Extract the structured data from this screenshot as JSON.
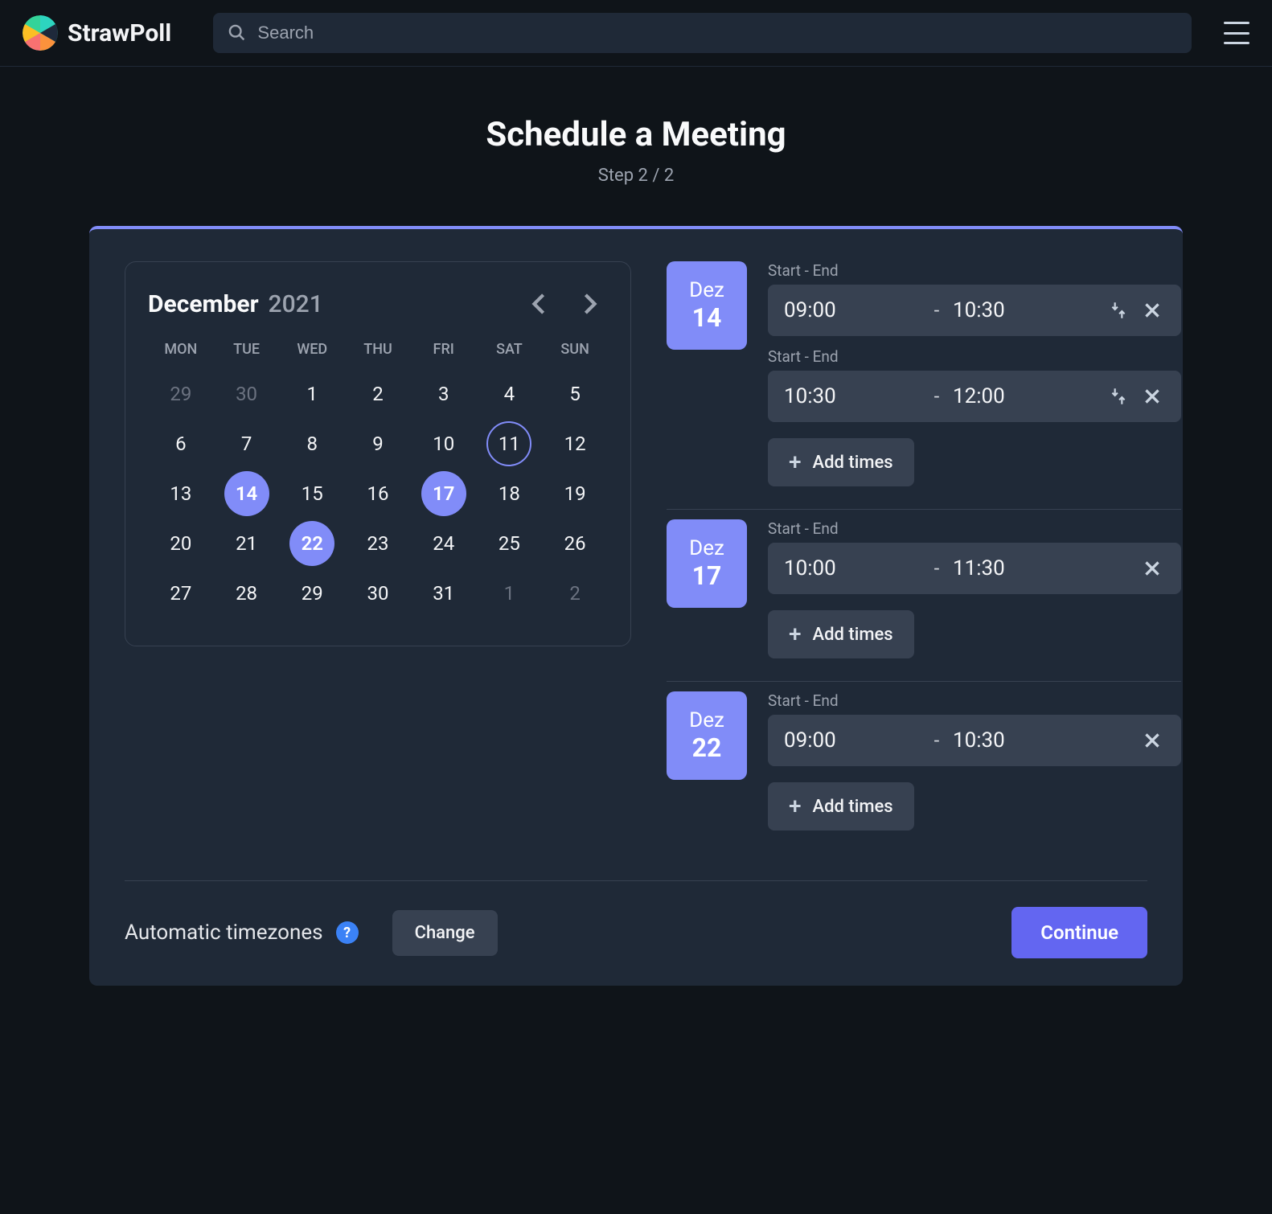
{
  "brand": "StrawPoll",
  "search": {
    "placeholder": "Search"
  },
  "title": "Schedule a Meeting",
  "step": "Step 2 / 2",
  "calendar": {
    "month": "December",
    "year": "2021",
    "dow": [
      "MON",
      "TUE",
      "WED",
      "THU",
      "FRI",
      "SAT",
      "SUN"
    ],
    "weeks": [
      [
        {
          "n": "29",
          "muted": true
        },
        {
          "n": "30",
          "muted": true
        },
        {
          "n": "1"
        },
        {
          "n": "2"
        },
        {
          "n": "3"
        },
        {
          "n": "4"
        },
        {
          "n": "5"
        }
      ],
      [
        {
          "n": "6"
        },
        {
          "n": "7"
        },
        {
          "n": "8"
        },
        {
          "n": "9"
        },
        {
          "n": "10"
        },
        {
          "n": "11",
          "today": true
        },
        {
          "n": "12"
        }
      ],
      [
        {
          "n": "13"
        },
        {
          "n": "14",
          "selected": true
        },
        {
          "n": "15"
        },
        {
          "n": "16"
        },
        {
          "n": "17",
          "selected": true
        },
        {
          "n": "18"
        },
        {
          "n": "19"
        }
      ],
      [
        {
          "n": "20"
        },
        {
          "n": "21"
        },
        {
          "n": "22",
          "selected": true
        },
        {
          "n": "23"
        },
        {
          "n": "24"
        },
        {
          "n": "25"
        },
        {
          "n": "26"
        }
      ],
      [
        {
          "n": "27"
        },
        {
          "n": "28"
        },
        {
          "n": "29"
        },
        {
          "n": "30"
        },
        {
          "n": "31"
        },
        {
          "n": "1",
          "muted": true
        },
        {
          "n": "2",
          "muted": true
        }
      ]
    ]
  },
  "slot_label": "Start - End",
  "add_times": "Add times",
  "groups": [
    {
      "month": "Dez",
      "day": "14",
      "slots": [
        {
          "start": "09:00",
          "end": "10:30",
          "copyable": true
        },
        {
          "start": "10:30",
          "end": "12:00",
          "copyable": true
        }
      ]
    },
    {
      "month": "Dez",
      "day": "17",
      "slots": [
        {
          "start": "10:00",
          "end": "11:30",
          "copyable": false
        }
      ]
    },
    {
      "month": "Dez",
      "day": "22",
      "slots": [
        {
          "start": "09:00",
          "end": "10:30",
          "copyable": false
        }
      ]
    }
  ],
  "tz_label": "Automatic timezones",
  "change": "Change",
  "continue": "Continue"
}
